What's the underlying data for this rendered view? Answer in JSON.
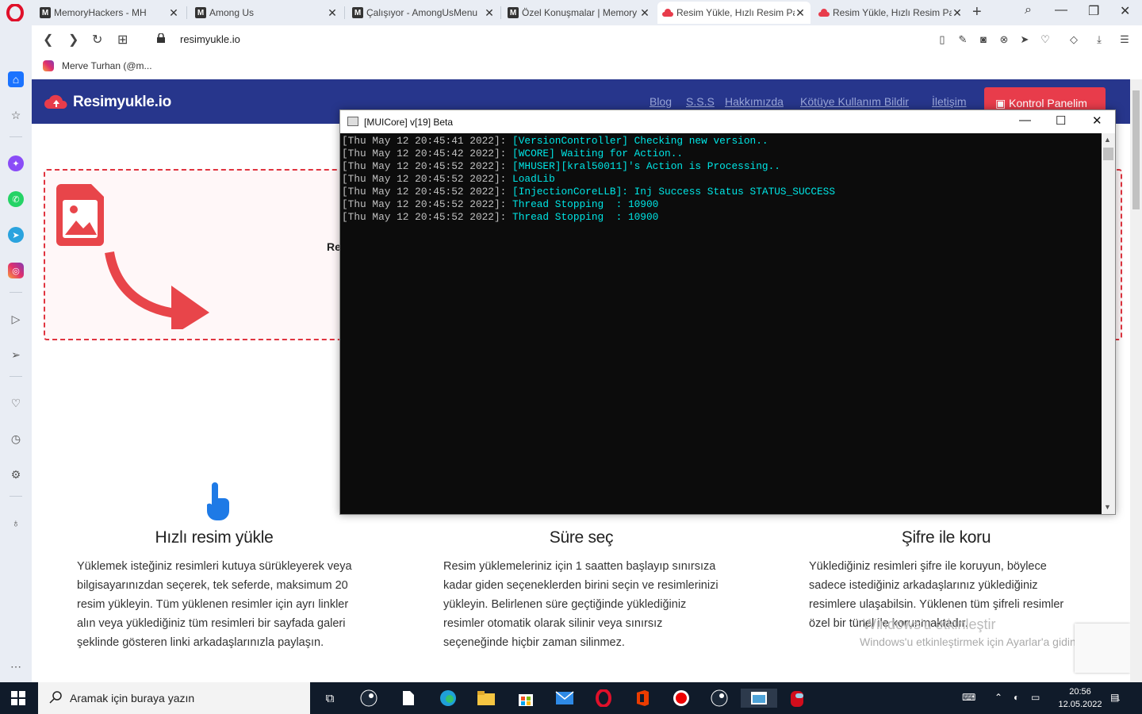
{
  "browser": {
    "tabs": [
      {
        "label": "MemoryHackers - MH",
        "favicon": "M"
      },
      {
        "label": "Among Us",
        "favicon": "M"
      },
      {
        "label": "Çalışıyor - AmongUsMenu",
        "favicon": "M"
      },
      {
        "label": "Özel Konuşmalar | Memory",
        "favicon": "M"
      },
      {
        "label": "Resim Yükle, Hızlı Resim Pa",
        "favicon": "cloud",
        "active": true
      },
      {
        "label": "Resim Yükle, Hızlı Resim Pa",
        "favicon": "cloud"
      }
    ],
    "url": "resimyukle.io",
    "bookmark": "Merve Turhan (@m..."
  },
  "site": {
    "logo": "Resimyukle.io",
    "nav": [
      "Blog",
      "S.S.S",
      "Hakkımızda",
      "Kötüye Kullanım Bildir",
      "İletişim"
    ],
    "panel_button": "Kontrol Panelim",
    "dropzone_text": "Re",
    "features": [
      {
        "title": "Hızlı resim yükle",
        "text": "Yüklemek isteğiniz resimleri kutuya sürükleyerek veya bilgisayarınızdan seçerek, tek seferde, maksimum 20 resim yükleyin. Tüm yüklenen resimler için ayrı linkler alın veya yüklediğiniz tüm resimleri bir sayfada galeri şeklinde gösteren linki arkadaşlarınızla paylaşın."
      },
      {
        "title": "Süre seç",
        "text": "Resim yüklemeleriniz için 1 saatten başlayıp sınırsıza kadar giden seçeneklerden birini seçin ve resimlerinizi yükleyin. Belirlenen süre geçtiğinde yüklediğiniz resimler otomatik olarak silinir veya sınırsız seçeneğinde hiçbir zaman silinmez."
      },
      {
        "title": "Şifre ile koru",
        "text": "Yüklediğiniz resimleri şifre ile koruyun, böylece sadece istediğiniz arkadaşlarınız yüklediğiniz resimlere ulaşabilsin. Yüklenen tüm şifreli resimler özel bir tünel ile korunmaktadır."
      }
    ],
    "watermark_title": "Windows'u etkinleştir",
    "watermark_sub": "Windows'u etkinleştirmek için Ayarlar'a gidin."
  },
  "console": {
    "title": "[MUICore] v[19] Beta",
    "lines": [
      {
        "ts": "[Thu May 12 20:45:41 2022]: ",
        "msg": "[VersionController] Checking new version.."
      },
      {
        "ts": "[Thu May 12 20:45:42 2022]: ",
        "msg": "[WCORE] Waiting for Action.."
      },
      {
        "ts": "[Thu May 12 20:45:52 2022]: ",
        "msg": "[MHUSER][kral50011]'s Action is Processing.."
      },
      {
        "ts": "[Thu May 12 20:45:52 2022]: ",
        "msg": "LoadLib"
      },
      {
        "ts": "[Thu May 12 20:45:52 2022]: ",
        "msg": "[InjectionCoreLLB]: Inj Success Status STATUS_SUCCESS"
      },
      {
        "ts": "[Thu May 12 20:45:52 2022]: ",
        "msg": "Thread Stopping  : 10900"
      },
      {
        "ts": "[Thu May 12 20:45:52 2022]: ",
        "msg": "Thread Stopping  : 10900"
      }
    ]
  },
  "taskbar": {
    "search_placeholder": "Aramak için buraya yazın",
    "time": "20:56",
    "date": "12.05.2022",
    "notifications": "1"
  },
  "colors": {
    "site_header": "#27368c",
    "accent_red": "#e83c4b",
    "console_text": "#00e5e5"
  }
}
